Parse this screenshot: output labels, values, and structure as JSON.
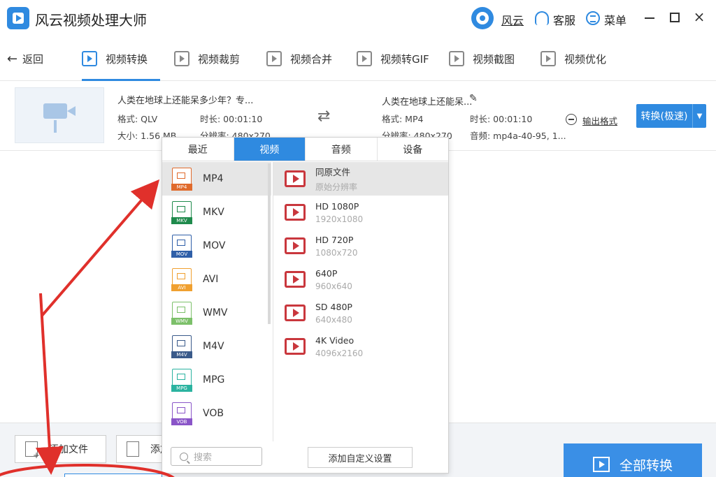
{
  "app": {
    "title": "风云视频处理大师"
  },
  "header": {
    "user_name": "风云",
    "service_label": "客服",
    "menu_label": "菜单",
    "close_glyph": "×"
  },
  "toolbar": {
    "back_label": "返回",
    "tabs": [
      {
        "label": "视频转换",
        "active": true
      },
      {
        "label": "视频裁剪"
      },
      {
        "label": "视频合并"
      },
      {
        "label": "视频转GIF"
      },
      {
        "label": "视频截图"
      },
      {
        "label": "视频优化"
      }
    ]
  },
  "file": {
    "source_name": "人类在地球上还能呆多少年？专...",
    "source_format": "格式: QLV",
    "source_duration": "时长: 00:01:10",
    "source_size": "大小: 1.56 MB",
    "source_resolution": "分辨率: 480x270",
    "output_name": "人类在地球上还能呆...",
    "output_format": "格式: MP4",
    "output_duration": "时长: 00:01:10",
    "output_resolution": "分辨率: 480x270",
    "output_audio": "音频: mp4a-40-95, 1...",
    "output_format_label": "输出格式",
    "convert_label": "转换(极速)",
    "convert_drop_glyph": "▼"
  },
  "format_popup": {
    "tabs": [
      "最近",
      "视频",
      "音频",
      "设备"
    ],
    "active_tab": 1,
    "formats": [
      {
        "label": "MP4",
        "tag": "MP4",
        "color": "#e06a2c"
      },
      {
        "label": "MKV",
        "tag": "MKV",
        "color": "#1f8a4c"
      },
      {
        "label": "MOV",
        "tag": "MOV",
        "color": "#2f5fa8"
      },
      {
        "label": "AVI",
        "tag": "AVI",
        "color": "#f0a030"
      },
      {
        "label": "WMV",
        "tag": "WMV",
        "color": "#7cc06a"
      },
      {
        "label": "M4V",
        "tag": "M4V",
        "color": "#3a5a8a"
      },
      {
        "label": "MPG",
        "tag": "MPG",
        "color": "#2bb3a0"
      },
      {
        "label": "VOB",
        "tag": "VOB",
        "color": "#8a55c8"
      }
    ],
    "presets": [
      {
        "name": "同原文件",
        "res": "原始分辨率"
      },
      {
        "name": "HD 1080P",
        "res": "1920x1080"
      },
      {
        "name": "HD 720P",
        "res": "1080x720"
      },
      {
        "name": "640P",
        "res": "960x640"
      },
      {
        "name": "SD 480P",
        "res": "640x480"
      },
      {
        "name": "4K Video",
        "res": "4096x2160"
      }
    ],
    "search_placeholder": "搜索",
    "custom_label": "添加自定义设置"
  },
  "bottom": {
    "add_file_label": "添加文件",
    "add_folder_label": "添加",
    "convert_all_label": "全部转换"
  },
  "annotation": {
    "color": "#e0302b"
  }
}
